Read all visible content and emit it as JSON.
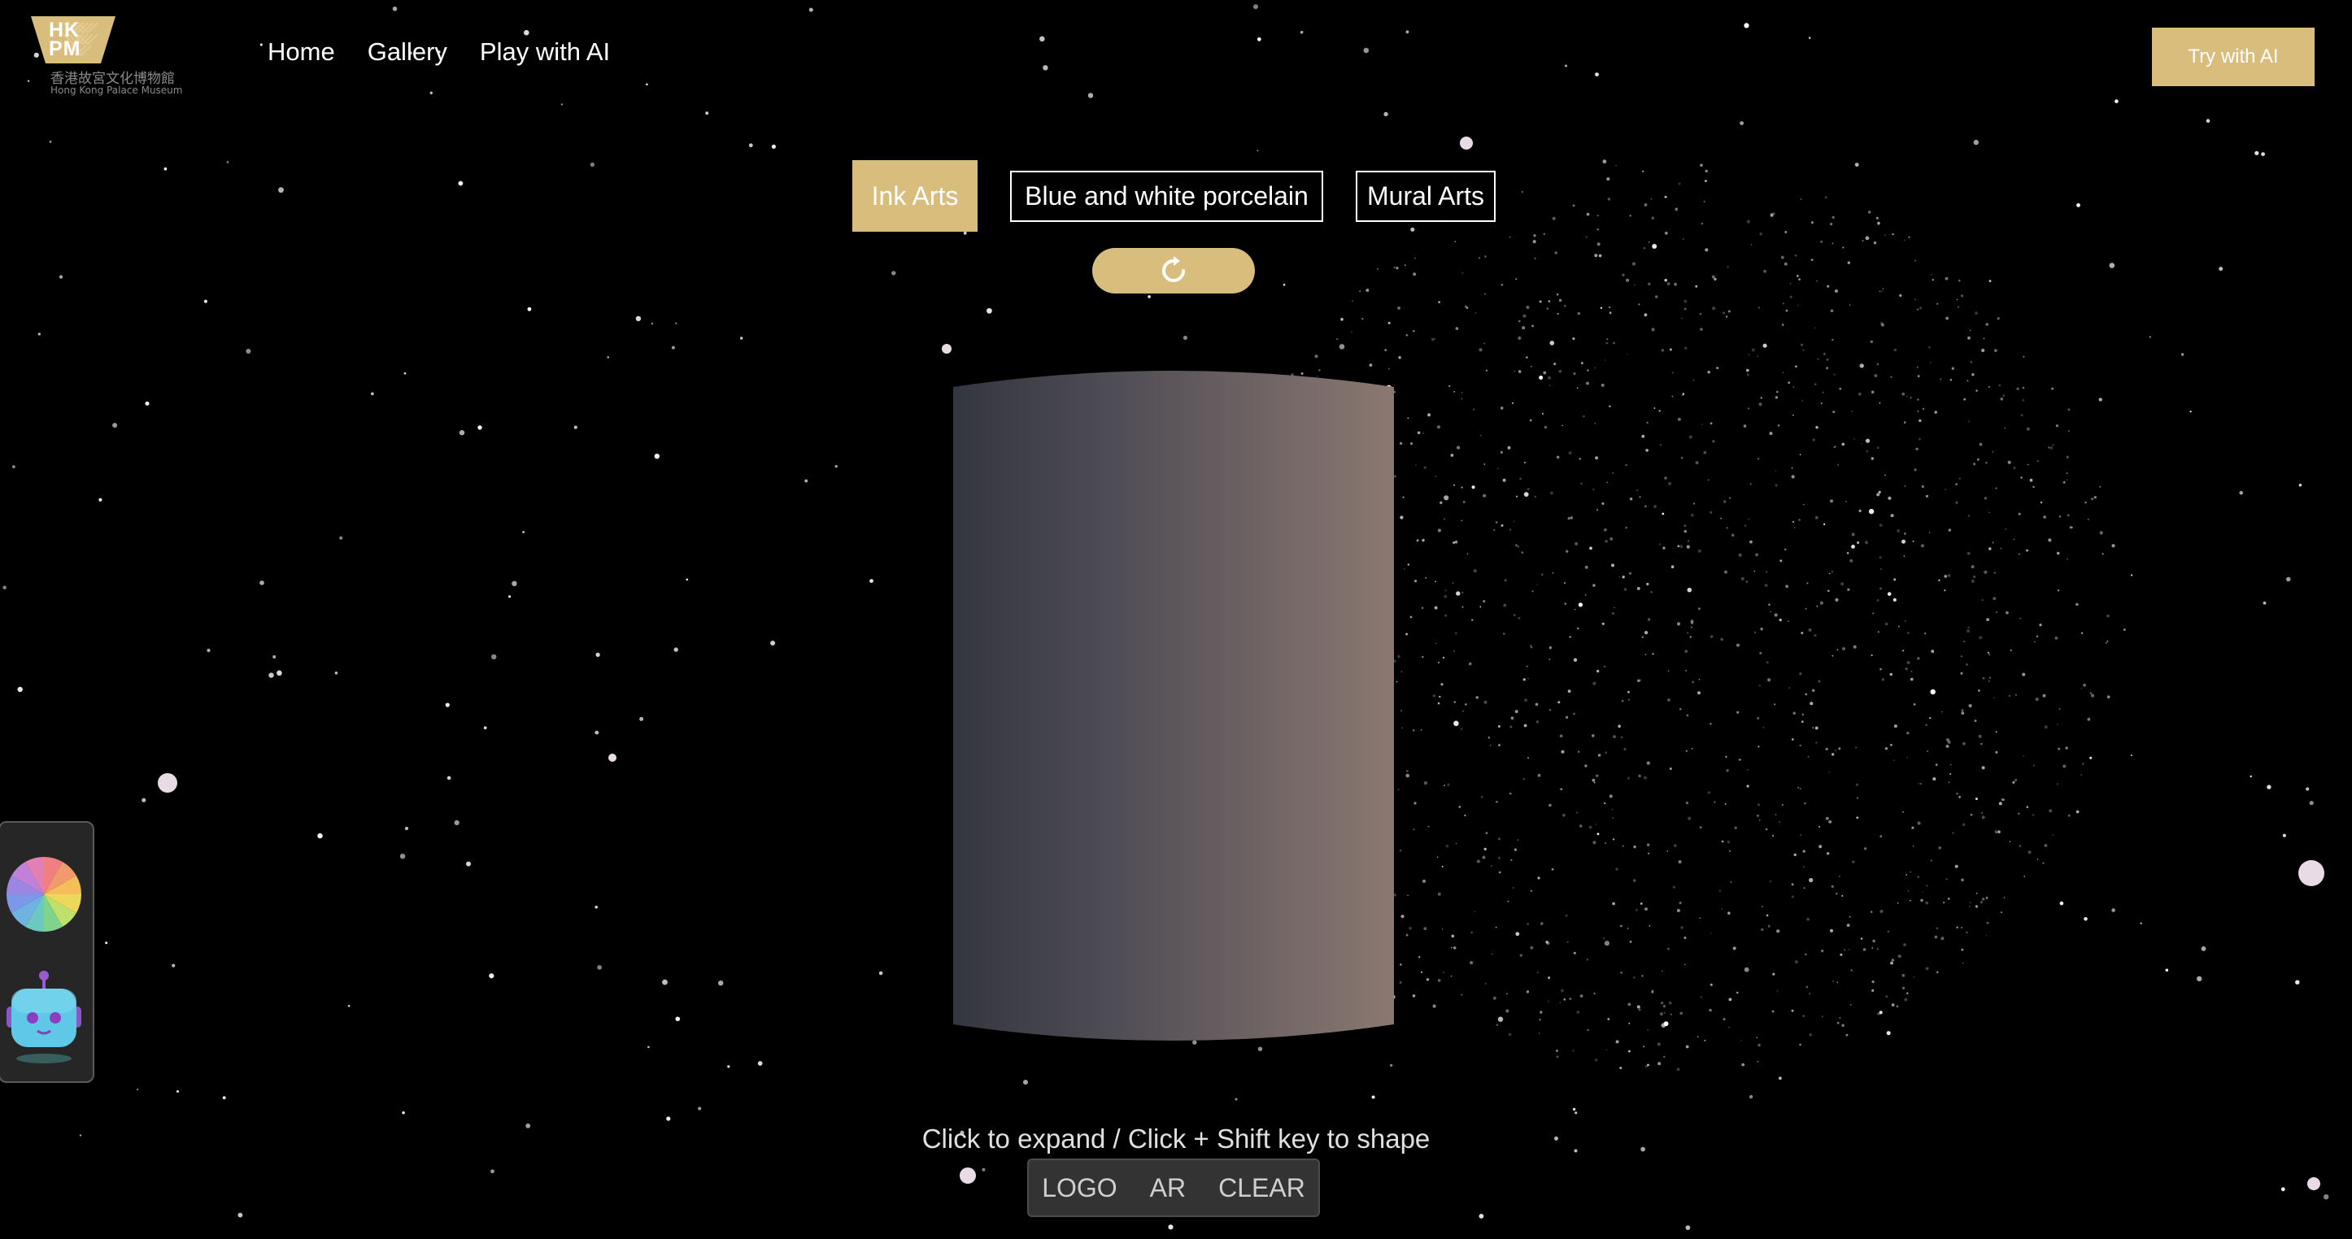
{
  "logo": {
    "mark_text_line1": "HK",
    "mark_text_line2": "PM",
    "chinese": "香港故宮文化博物館",
    "english": "Hong Kong Palace Museum"
  },
  "nav": {
    "items": [
      "Home",
      "Gallery",
      "Play with AI"
    ]
  },
  "try_ai": "Try with AI",
  "categories": [
    "Ink Arts",
    "Blue and white porcelain",
    "Mural Arts"
  ],
  "active_category": "Ink Arts",
  "reset_icon": "refresh-icon",
  "side_panel": {
    "icons": [
      "color-wheel-icon",
      "robot-icon"
    ]
  },
  "hint": "Click to expand / Click + Shift key to shape",
  "toolbar": {
    "logo": "LOGO",
    "ar": "AR",
    "clear": "CLEAR"
  },
  "colors": {
    "accent": "#d9bd7c",
    "background": "#000000",
    "cylinder_left": "#383a44",
    "cylinder_right": "#8b7870"
  }
}
